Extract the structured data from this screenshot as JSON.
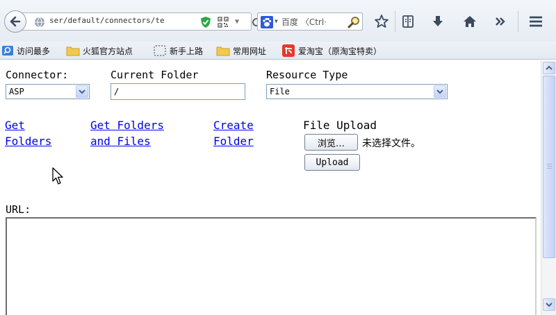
{
  "browser": {
    "url_text": "ser/default/connectors/te",
    "search_text": "百度 〈Ctrl·",
    "bookmarks": [
      {
        "label": "访问最多",
        "icon": "search-folder-icon"
      },
      {
        "label": "火狐官方站点",
        "icon": "folder-icon"
      },
      {
        "label": "新手上路",
        "icon": "dashed-folder-icon"
      },
      {
        "label": "常用网址",
        "icon": "folder-icon"
      },
      {
        "label": "爱淘宝（原淘宝特卖）",
        "icon": "taobao-icon"
      }
    ],
    "toolbar_icons": [
      "star-icon",
      "reading-list-icon",
      "download-icon",
      "home-icon",
      "overflow-icon",
      "menu-icon"
    ],
    "colors": {
      "shield": "#2aa84a",
      "taobao": "#e8382b",
      "folder": "#f2c94c",
      "link": "#0000ee"
    }
  },
  "form": {
    "connector_label": "Connector:",
    "connector_value": "ASP",
    "current_folder_label": "Current Folder",
    "current_folder_value": "/",
    "resource_type_label": "Resource Type",
    "resource_type_value": "File",
    "links": {
      "get_folders_line1": "Get",
      "get_folders_line2": "Folders",
      "get_folders_files_line1": "Get Folders",
      "get_folders_files_line2": "and Files",
      "create_folder_line1": "Create",
      "create_folder_line2": "Folder"
    },
    "file_upload_label": "File Upload",
    "browse_button": "浏览…",
    "no_file_text": "未选择文件。",
    "upload_button": "Upload",
    "url_label": "URL:"
  }
}
